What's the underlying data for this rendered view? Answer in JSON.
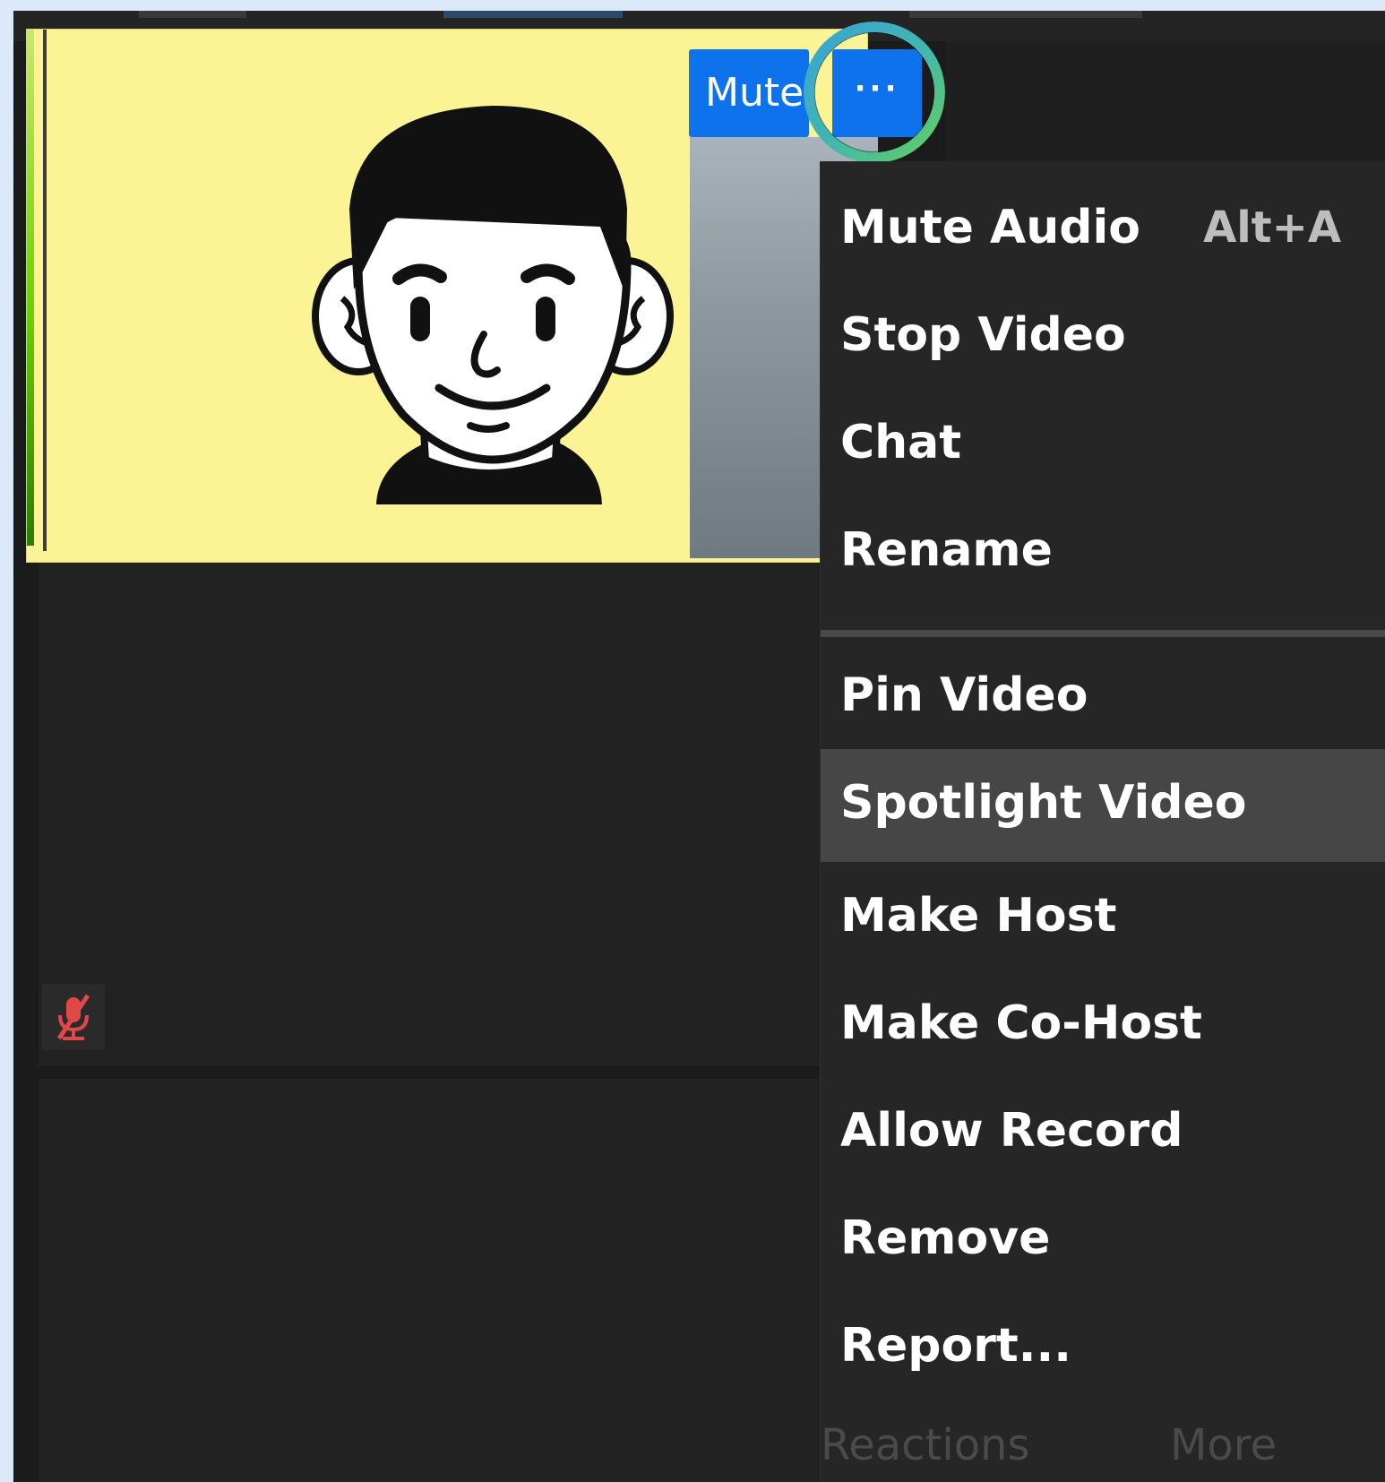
{
  "video_tile": {
    "mute_button_label": "Mute",
    "more_button_label": "···",
    "more_button_icon": "more-options-icon"
  },
  "participant_status": {
    "mic_state_icon": "muted-microphone-icon"
  },
  "context_menu": {
    "items": [
      {
        "label": "Mute Audio",
        "shortcut": "Alt+A"
      },
      {
        "label": "Stop Video"
      },
      {
        "label": "Chat"
      },
      {
        "label": "Rename"
      },
      {
        "label": "Pin Video"
      },
      {
        "label": "Spotlight Video"
      },
      {
        "label": "Make Host"
      },
      {
        "label": "Make Co-Host"
      },
      {
        "label": "Allow Record"
      },
      {
        "label": "Remove"
      },
      {
        "label": "Report..."
      }
    ],
    "hovered_item": "Spotlight Video"
  },
  "toolbar_behind_menu": {
    "reactions_label": "Reactions",
    "more_label": "More"
  },
  "colors": {
    "accent_blue": "#0e72ed",
    "tile_bg": "#fbf394",
    "menu_bg": "#262626",
    "menu_hover": "#464646",
    "highlight_ring": "#40b6b2"
  }
}
